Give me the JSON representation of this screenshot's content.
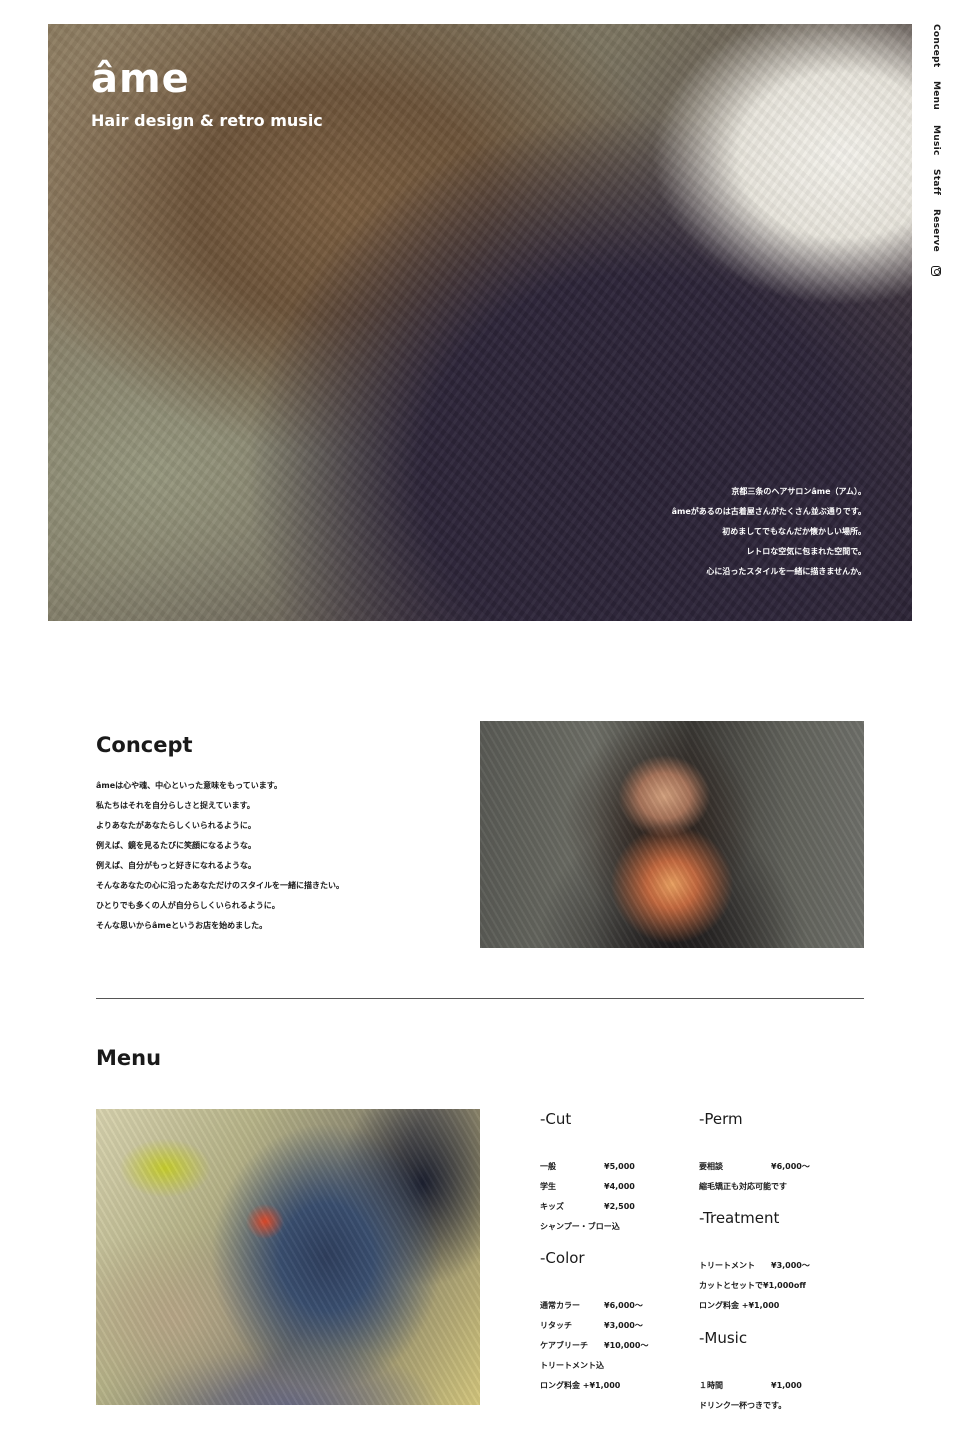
{
  "brand": {
    "logo": "âme",
    "tagline": "Hair design & retro music"
  },
  "nav": {
    "items": [
      "Concept",
      "Menu",
      "Music",
      "Staff",
      "Reserve"
    ],
    "instagram_icon": "instagram-icon"
  },
  "hero": {
    "lines": [
      "京都三条のヘアサロンâme（アム）。",
      "âmeがあるのは古着屋さんがたくさん並ぶ通りです。",
      "初めましてでもなんだか懐かしい場所。",
      "レトロな空気に包まれた空間で。",
      "心に沿ったスタイルを一緒に描きませんか。"
    ]
  },
  "concept": {
    "title": "Concept",
    "lines": [
      "âmeは心や魂、中心といった意味をもっています。",
      "私たちはそれを自分らしさと捉えています。",
      "よりあなたがあなたらしくいられるように。",
      "例えば、鏡を見るたびに笑顔になるような。",
      "例えば、自分がもっと好きになれるような。",
      "そんなあなたの心に沿ったあなただけのスタイルを一緒に描きたい。",
      "ひとりでも多くの人が自分らしくいられるように。",
      "そんな思いからâmeというお店を始めました。"
    ]
  },
  "menu": {
    "title": "Menu",
    "cut": {
      "heading": "-Cut",
      "rows": [
        {
          "item": "一般",
          "price": "¥5,000"
        },
        {
          "item": "学生",
          "price": "¥4,000"
        },
        {
          "item": "キッズ",
          "price": "¥2,500"
        }
      ],
      "note": "シャンプー・ブロー込"
    },
    "color": {
      "heading": "-Color",
      "rows": [
        {
          "item": "通常カラー",
          "price": "¥6,000〜"
        },
        {
          "item": "リタッチ",
          "price": "¥3,000〜"
        },
        {
          "item": "ケアブリーチ",
          "price": "¥10,000〜"
        }
      ],
      "notes": [
        "トリートメント込",
        "ロング料金 +¥1,000"
      ]
    },
    "perm": {
      "heading": "-Perm",
      "rows": [
        {
          "item": "要相談",
          "price": "¥6,000〜"
        }
      ],
      "note": "縮毛矯正も対応可能です"
    },
    "treatment": {
      "heading": "-Treatment",
      "rows": [
        {
          "item": "トリートメント",
          "price": "¥3,000〜"
        }
      ],
      "notes": [
        "カットとセットで¥1,000off",
        "ロング料金 +¥1,000"
      ]
    },
    "music": {
      "heading": "-Music",
      "rows": [
        {
          "item": "１時間",
          "price": "¥1,000"
        }
      ],
      "note": "ドリンク一杯つきです。"
    }
  }
}
